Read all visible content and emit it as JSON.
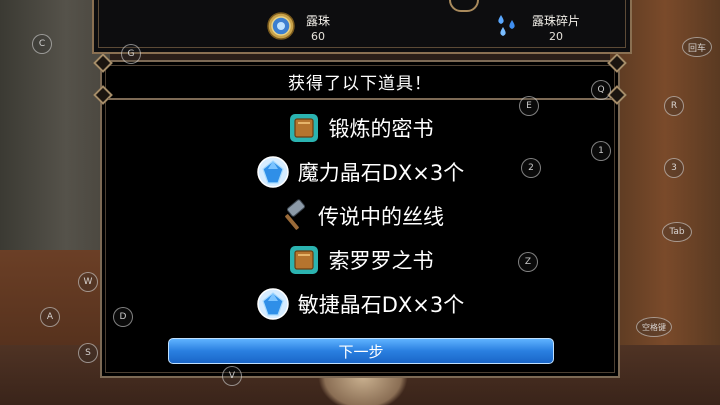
{
  "top_bar": {
    "currencies": [
      {
        "name": "露珠",
        "value": "60",
        "icon": "medal-icon"
      },
      {
        "name": "露珠碎片",
        "value": "20",
        "icon": "droplets-icon"
      }
    ]
  },
  "dialog": {
    "title": "获得了以下道具！",
    "items": [
      {
        "label": "锻炼的密书",
        "icon": "book-icon"
      },
      {
        "label": "魔力晶石DX×3个",
        "icon": "crystal-icon"
      },
      {
        "label": "传说中的丝线",
        "icon": "hammer-icon"
      },
      {
        "label": "索罗罗之书",
        "icon": "book-icon"
      },
      {
        "label": "敏捷晶石DX×3个",
        "icon": "crystal-icon"
      }
    ],
    "next_button": "下一步"
  },
  "virtual_keys": [
    "C",
    "G",
    "E",
    "Q",
    "2",
    "1",
    "Z",
    "W",
    "A",
    "D",
    "S",
    "V",
    "回车",
    "R",
    "3",
    "Tab",
    "空格键"
  ],
  "colors": {
    "button_blue": "#2a7fe0",
    "frame_gold": "#a58c68",
    "dialog_bg": "#000000"
  }
}
